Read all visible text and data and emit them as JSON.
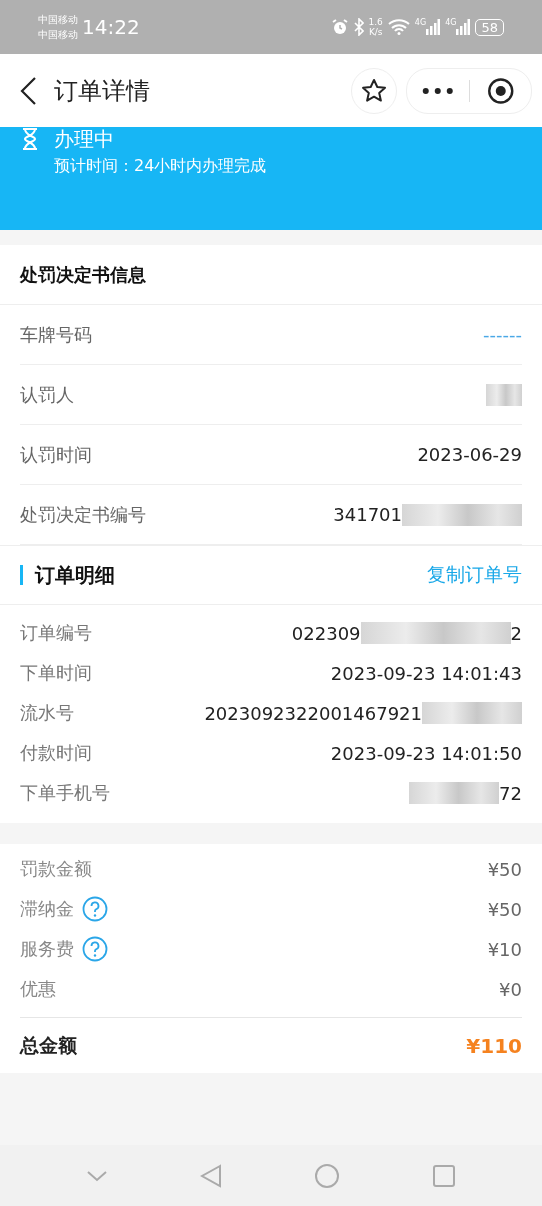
{
  "status_bar": {
    "carriers": [
      "中国移动",
      "中国移动"
    ],
    "time": "14:22",
    "speed": "1.6",
    "speed_unit": "K/s",
    "networks": [
      "4G",
      "4G"
    ],
    "battery": "58"
  },
  "nav_bar": {
    "title": "订单详情"
  },
  "banner": {
    "status": "办理中",
    "note": "预计时间：24小时内办理完成"
  },
  "decision": {
    "title": "处罚决定书信息",
    "rows": [
      {
        "label": "车牌号码",
        "value": "------",
        "kind": "link",
        "redacted": false
      },
      {
        "label": "认罚人",
        "value": "",
        "kind": "plain",
        "redacted": true
      },
      {
        "label": "认罚时间",
        "value": "2023-06-29",
        "kind": "plain",
        "redacted": false
      },
      {
        "label": "处罚决定书编号",
        "value": "341701",
        "kind": "plain",
        "redacted": true
      }
    ]
  },
  "order": {
    "title": "订单明细",
    "action": "复制订单号",
    "rows": [
      {
        "label": "订单编号",
        "value": "022309",
        "tail": "2",
        "redacted": true
      },
      {
        "label": "下单时间",
        "value": "2023-09-23 14:01:43",
        "redacted": false
      },
      {
        "label": "流水号",
        "value": "2023092322001467921",
        "redacted": true
      },
      {
        "label": "付款时间",
        "value": "2023-09-23 14:01:50",
        "redacted": false
      },
      {
        "label": "下单手机号",
        "value": "",
        "tail": "72",
        "redacted": true
      }
    ]
  },
  "fees": {
    "rows": [
      {
        "label": "罚款金额",
        "value": "¥50",
        "help": false
      },
      {
        "label": "滞纳金",
        "value": "¥50",
        "help": true
      },
      {
        "label": "服务费",
        "value": "¥10",
        "help": true
      },
      {
        "label": "优惠",
        "value": "¥0",
        "help": false
      }
    ],
    "total_label": "总金额",
    "total": "¥110"
  }
}
